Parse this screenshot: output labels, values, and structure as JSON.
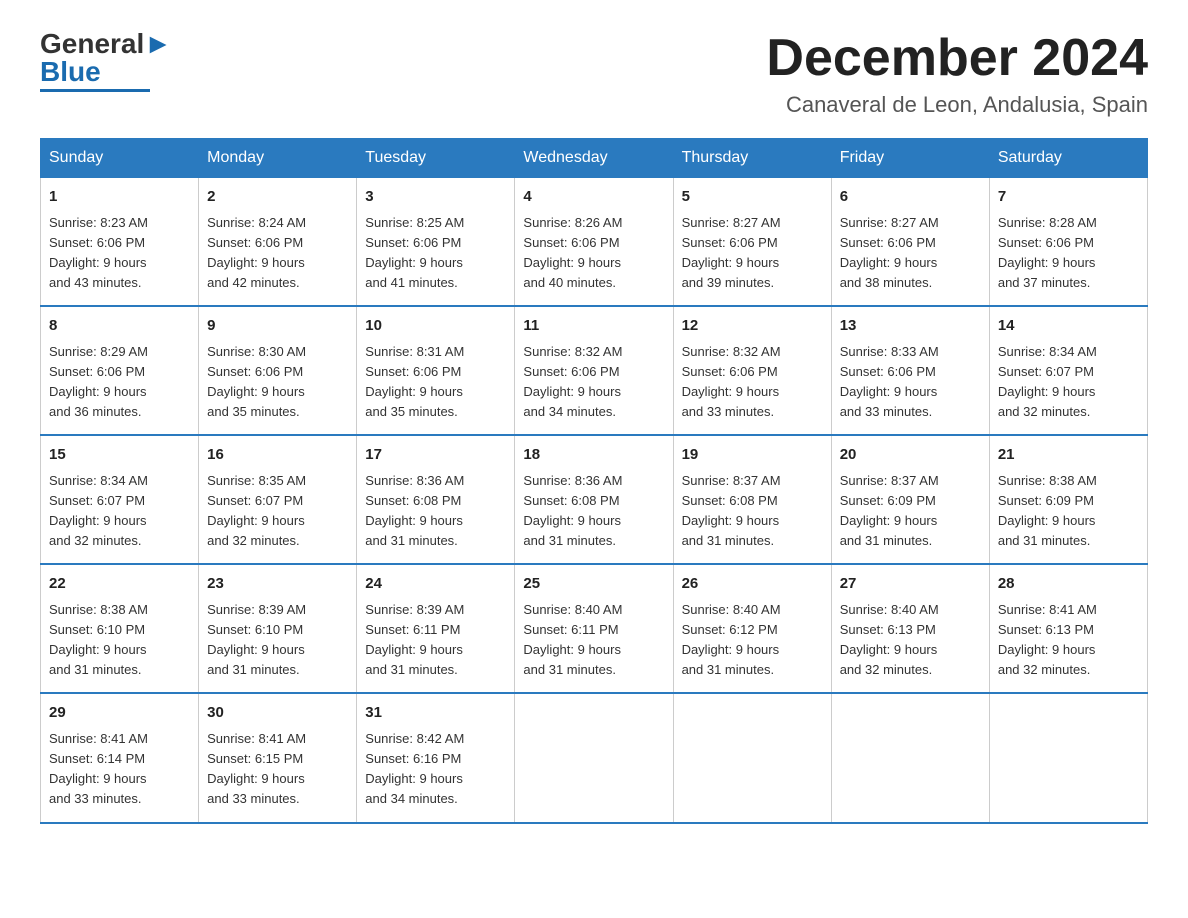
{
  "logo": {
    "text_general": "General",
    "text_blue": "Blue"
  },
  "header": {
    "month": "December 2024",
    "location": "Canaveral de Leon, Andalusia, Spain"
  },
  "weekdays": [
    "Sunday",
    "Monday",
    "Tuesday",
    "Wednesday",
    "Thursday",
    "Friday",
    "Saturday"
  ],
  "weeks": [
    [
      {
        "day": "1",
        "sunrise": "8:23 AM",
        "sunset": "6:06 PM",
        "daylight": "9 hours and 43 minutes."
      },
      {
        "day": "2",
        "sunrise": "8:24 AM",
        "sunset": "6:06 PM",
        "daylight": "9 hours and 42 minutes."
      },
      {
        "day": "3",
        "sunrise": "8:25 AM",
        "sunset": "6:06 PM",
        "daylight": "9 hours and 41 minutes."
      },
      {
        "day": "4",
        "sunrise": "8:26 AM",
        "sunset": "6:06 PM",
        "daylight": "9 hours and 40 minutes."
      },
      {
        "day": "5",
        "sunrise": "8:27 AM",
        "sunset": "6:06 PM",
        "daylight": "9 hours and 39 minutes."
      },
      {
        "day": "6",
        "sunrise": "8:27 AM",
        "sunset": "6:06 PM",
        "daylight": "9 hours and 38 minutes."
      },
      {
        "day": "7",
        "sunrise": "8:28 AM",
        "sunset": "6:06 PM",
        "daylight": "9 hours and 37 minutes."
      }
    ],
    [
      {
        "day": "8",
        "sunrise": "8:29 AM",
        "sunset": "6:06 PM",
        "daylight": "9 hours and 36 minutes."
      },
      {
        "day": "9",
        "sunrise": "8:30 AM",
        "sunset": "6:06 PM",
        "daylight": "9 hours and 35 minutes."
      },
      {
        "day": "10",
        "sunrise": "8:31 AM",
        "sunset": "6:06 PM",
        "daylight": "9 hours and 35 minutes."
      },
      {
        "day": "11",
        "sunrise": "8:32 AM",
        "sunset": "6:06 PM",
        "daylight": "9 hours and 34 minutes."
      },
      {
        "day": "12",
        "sunrise": "8:32 AM",
        "sunset": "6:06 PM",
        "daylight": "9 hours and 33 minutes."
      },
      {
        "day": "13",
        "sunrise": "8:33 AM",
        "sunset": "6:06 PM",
        "daylight": "9 hours and 33 minutes."
      },
      {
        "day": "14",
        "sunrise": "8:34 AM",
        "sunset": "6:07 PM",
        "daylight": "9 hours and 32 minutes."
      }
    ],
    [
      {
        "day": "15",
        "sunrise": "8:34 AM",
        "sunset": "6:07 PM",
        "daylight": "9 hours and 32 minutes."
      },
      {
        "day": "16",
        "sunrise": "8:35 AM",
        "sunset": "6:07 PM",
        "daylight": "9 hours and 32 minutes."
      },
      {
        "day": "17",
        "sunrise": "8:36 AM",
        "sunset": "6:08 PM",
        "daylight": "9 hours and 31 minutes."
      },
      {
        "day": "18",
        "sunrise": "8:36 AM",
        "sunset": "6:08 PM",
        "daylight": "9 hours and 31 minutes."
      },
      {
        "day": "19",
        "sunrise": "8:37 AM",
        "sunset": "6:08 PM",
        "daylight": "9 hours and 31 minutes."
      },
      {
        "day": "20",
        "sunrise": "8:37 AM",
        "sunset": "6:09 PM",
        "daylight": "9 hours and 31 minutes."
      },
      {
        "day": "21",
        "sunrise": "8:38 AM",
        "sunset": "6:09 PM",
        "daylight": "9 hours and 31 minutes."
      }
    ],
    [
      {
        "day": "22",
        "sunrise": "8:38 AM",
        "sunset": "6:10 PM",
        "daylight": "9 hours and 31 minutes."
      },
      {
        "day": "23",
        "sunrise": "8:39 AM",
        "sunset": "6:10 PM",
        "daylight": "9 hours and 31 minutes."
      },
      {
        "day": "24",
        "sunrise": "8:39 AM",
        "sunset": "6:11 PM",
        "daylight": "9 hours and 31 minutes."
      },
      {
        "day": "25",
        "sunrise": "8:40 AM",
        "sunset": "6:11 PM",
        "daylight": "9 hours and 31 minutes."
      },
      {
        "day": "26",
        "sunrise": "8:40 AM",
        "sunset": "6:12 PM",
        "daylight": "9 hours and 31 minutes."
      },
      {
        "day": "27",
        "sunrise": "8:40 AM",
        "sunset": "6:13 PM",
        "daylight": "9 hours and 32 minutes."
      },
      {
        "day": "28",
        "sunrise": "8:41 AM",
        "sunset": "6:13 PM",
        "daylight": "9 hours and 32 minutes."
      }
    ],
    [
      {
        "day": "29",
        "sunrise": "8:41 AM",
        "sunset": "6:14 PM",
        "daylight": "9 hours and 33 minutes."
      },
      {
        "day": "30",
        "sunrise": "8:41 AM",
        "sunset": "6:15 PM",
        "daylight": "9 hours and 33 minutes."
      },
      {
        "day": "31",
        "sunrise": "8:42 AM",
        "sunset": "6:16 PM",
        "daylight": "9 hours and 34 minutes."
      },
      null,
      null,
      null,
      null
    ]
  ],
  "labels": {
    "sunrise": "Sunrise:",
    "sunset": "Sunset:",
    "daylight": "Daylight:"
  }
}
